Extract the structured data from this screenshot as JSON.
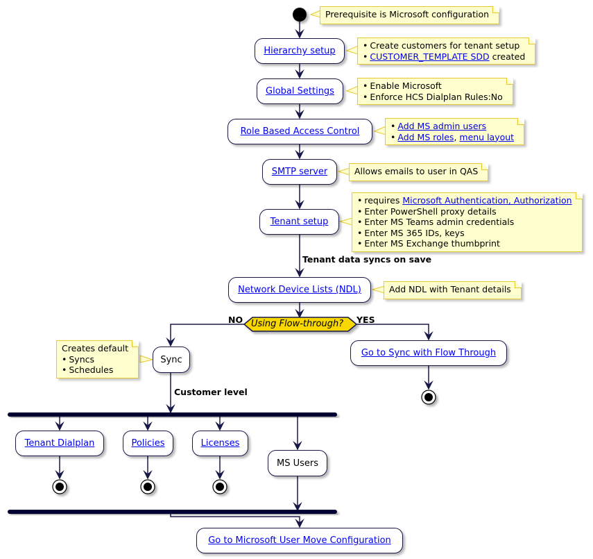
{
  "diagram": {
    "start_note": "Prerequisite is Microsoft configuration",
    "nodes": {
      "hierarchy": "Hierarchy setup",
      "global": "Global Settings",
      "rbac": "Role Based Access Control",
      "smtp": "SMTP server",
      "tenant": "Tenant setup",
      "ndl": "Network Device Lists (NDL)",
      "sync": "Sync",
      "flow_through": "Go to Sync with Flow Through",
      "dialplan": "Tenant Dialplan",
      "policies": "Policies",
      "licenses": "Licenses",
      "ms_users": "MS Users",
      "user_move": "Go to Microsoft User Move Configuration"
    },
    "notes": {
      "hierarchy": [
        "Create customers for tenant setup",
        {
          "link": "CUSTOMER_TEMPLATE SDD",
          "text": " created"
        }
      ],
      "global": [
        "Enable Microsoft",
        "Enforce HCS Dialplan Rules:No"
      ],
      "rbac": [
        {
          "link": "Add MS admin users"
        },
        {
          "link": "Add MS roles",
          "sep": ", ",
          "link2": "menu layout"
        }
      ],
      "smtp": "Allows emails to user in QAS",
      "tenant": [
        {
          "prefix": "requires ",
          "link": "Microsoft Authentication, Authorization"
        },
        "Enter PowerShell proxy details",
        "Enter MS Teams admin credentials",
        "Enter MS 365 IDs, keys",
        "Enter MS Exchange thumbprint"
      ],
      "ndl": "Add NDL with Tenant details",
      "sync_title": "Creates default",
      "sync_items": [
        "Syncs",
        "Schedules"
      ]
    },
    "edge_labels": {
      "tenant_to_ndl": "Tenant data syncs on save",
      "sync_to_fork": "Customer level",
      "no": "NO",
      "yes": "YES"
    },
    "decision": "Using Flow-through?",
    "colors": {
      "line": "#181848",
      "decision_fill": "#f8d800",
      "note_fill": "#fefece",
      "note_border": "#e8c830",
      "link": "#0000ee"
    }
  }
}
